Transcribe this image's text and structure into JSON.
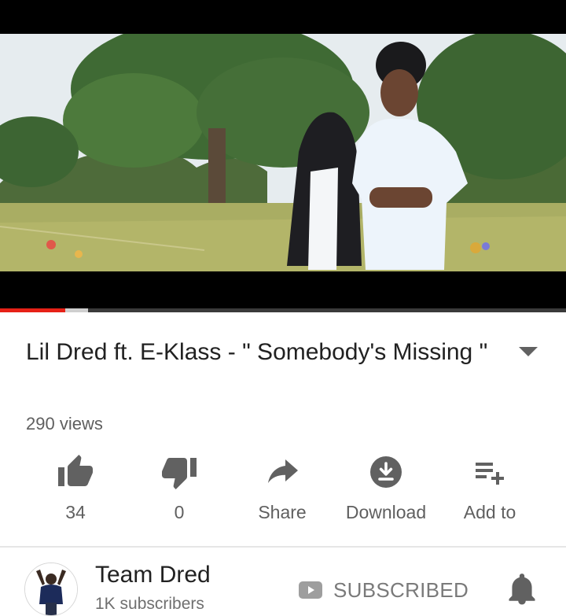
{
  "player": {
    "progress_played_fraction": 0.115,
    "progress_buffered_fraction": 0.155,
    "colors": {
      "played": "#e62117",
      "buffered": "#cfcfcf",
      "track": "#3a3a3a"
    }
  },
  "video": {
    "title": "Lil Dred ft. E-Klass - \" Somebody's Missing \"",
    "views": "290 views"
  },
  "actions": [
    {
      "id": "like",
      "icon": "thumbs-up-icon",
      "label": "34"
    },
    {
      "id": "dislike",
      "icon": "thumbs-down-icon",
      "label": "0"
    },
    {
      "id": "share",
      "icon": "share-arrow-icon",
      "label": "Share"
    },
    {
      "id": "download",
      "icon": "download-icon",
      "label": "Download"
    },
    {
      "id": "add-to",
      "icon": "playlist-add-icon",
      "label": "Add to"
    }
  ],
  "channel": {
    "name": "Team Dred",
    "subscribers": "1K subscribers",
    "subscribe_label": "SUBSCRIBED"
  },
  "icons": {
    "expand": "chevron-down-icon",
    "subscribe": "youtube-play-icon",
    "notifications": "bell-icon"
  }
}
